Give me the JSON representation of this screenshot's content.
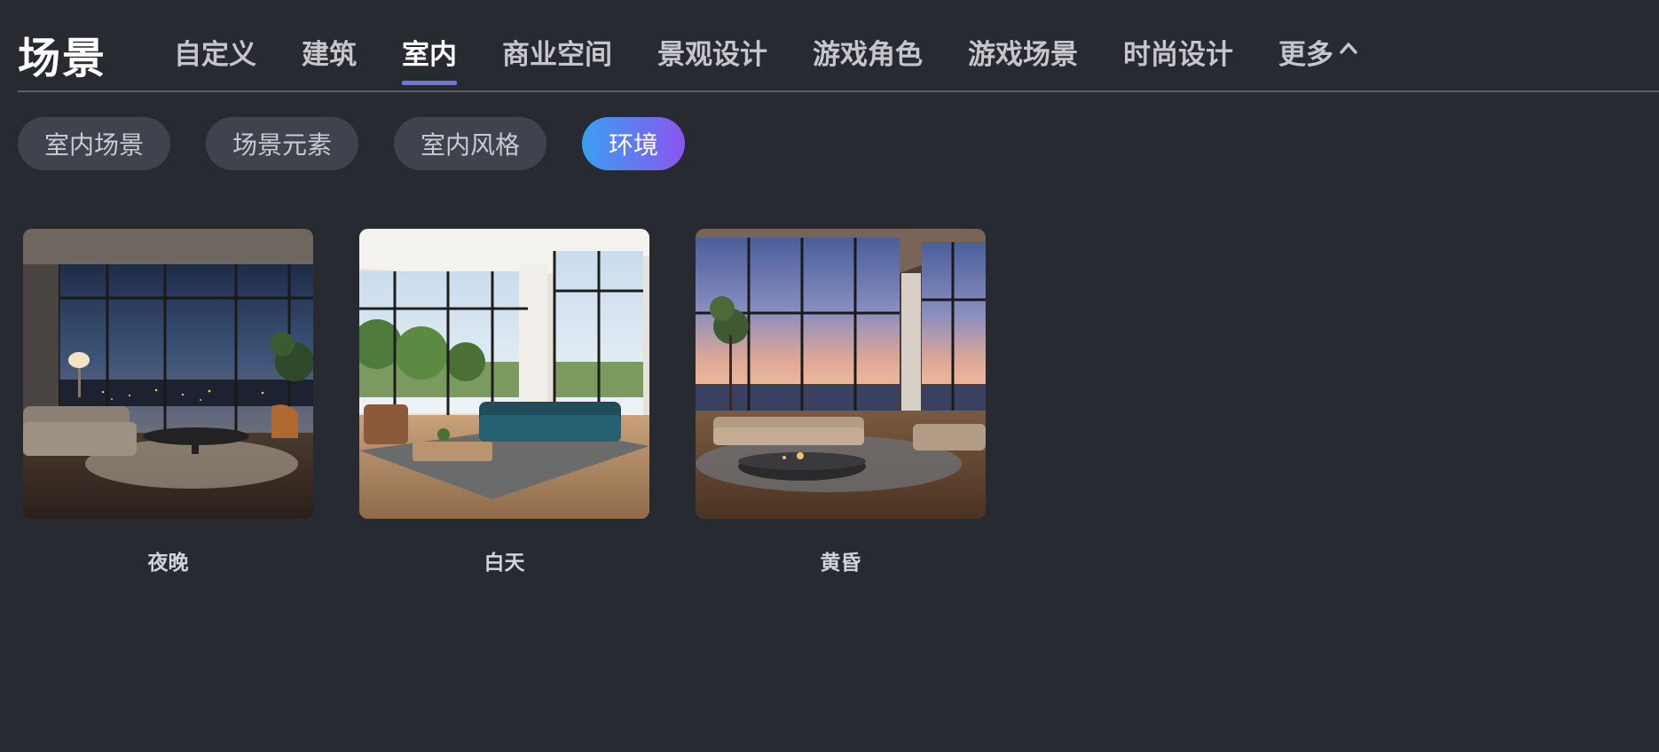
{
  "header": {
    "title": "场景",
    "tabs": [
      {
        "label": "自定义"
      },
      {
        "label": "建筑"
      },
      {
        "label": "室内",
        "active": true
      },
      {
        "label": "商业空间"
      },
      {
        "label": "景观设计"
      },
      {
        "label": "游戏角色"
      },
      {
        "label": "游戏场景"
      },
      {
        "label": "时尚设计"
      }
    ],
    "more_label": "更多",
    "more_icon": "chevron-up-icon",
    "underline_color": "#6f77d6"
  },
  "filters": {
    "chips": [
      {
        "label": "室内场景"
      },
      {
        "label": "场景元素"
      },
      {
        "label": "室内风格"
      },
      {
        "label": "环境",
        "active": true
      }
    ],
    "active_gradient": [
      "#3aa0f0",
      "#8a55f0"
    ]
  },
  "cards": [
    {
      "label": "夜晚",
      "image": "night-living-room-image"
    },
    {
      "label": "白天",
      "image": "day-living-room-image"
    },
    {
      "label": "黄昏",
      "image": "dusk-living-room-image"
    }
  ]
}
